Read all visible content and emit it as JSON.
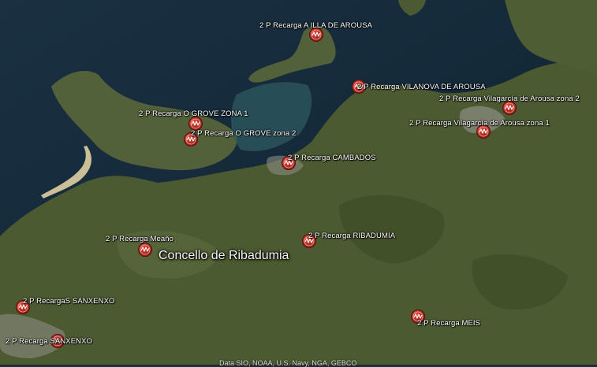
{
  "map": {
    "place_label": "Concello de Ribadumia",
    "attribution": "Data SIO, NOAA, U.S. Navy, NGA, GEBCO",
    "marker_icon": "ev-charging-pin-icon",
    "marker_color": "#c0281e"
  },
  "stations": [
    {
      "id": "illa-arousa",
      "label": "2 P Recarga A ILLA DE AROUSA"
    },
    {
      "id": "vilanova-arousa",
      "label": "2 P Recarga VILANOVA DE AROUSA"
    },
    {
      "id": "vilagarcia-zona2",
      "label": "2 P Recarga Vilagarcía de Arousa zona 2"
    },
    {
      "id": "vilagarcia-zona1",
      "label": "2 P Recarga Vilagarcía de Arousa zona 1"
    },
    {
      "id": "grove-zona1",
      "label": "2 P Recarga O GROVE ZONA 1"
    },
    {
      "id": "grove-zona2",
      "label": "2 P Recarga  O GROVE zona 2"
    },
    {
      "id": "cambados",
      "label": "2 P Recarga CAMBADOS"
    },
    {
      "id": "meano",
      "label": "2 P Recarga Meaño"
    },
    {
      "id": "ribadumia",
      "label": "2 P Recarga RIBADUMIA"
    },
    {
      "id": "s-sanxenxo",
      "label": "2 P RecargaS SANXENXO"
    },
    {
      "id": "sanxenxo",
      "label": "2 P Recarga SANXENXO"
    },
    {
      "id": "meis",
      "label": "2 P Recarga MEIS"
    }
  ]
}
